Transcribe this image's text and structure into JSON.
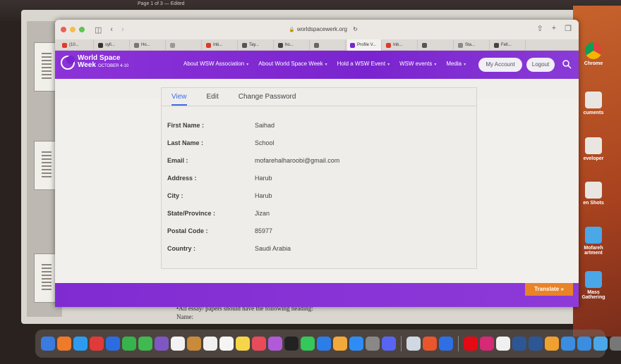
{
  "browser": {
    "url": "worldspacewerk.org",
    "tabs": [
      {
        "label": "(10...",
        "color": "#e03a2f"
      },
      {
        "label": "syll...",
        "color": "#333333"
      },
      {
        "label": "Ho...",
        "color": "#777777"
      },
      {
        "label": "",
        "color": "#999999"
      },
      {
        "label": "Inb...",
        "color": "#d93b2b"
      },
      {
        "label": "Tay...",
        "color": "#555555"
      },
      {
        "label": "ho...",
        "color": "#444444"
      },
      {
        "label": "",
        "color": "#666666"
      },
      {
        "label": "Profile V...",
        "color": "#7a24cf"
      },
      {
        "label": "Inb...",
        "color": "#d93b2b"
      },
      {
        "label": "",
        "color": "#555555"
      },
      {
        "label": "Sta...",
        "color": "#888888"
      },
      {
        "label": "Fell...",
        "color": "#444444"
      }
    ]
  },
  "site": {
    "logo_line1": "World Space",
    "logo_line2": "Week",
    "logo_sub": "OCTOBER 4-10",
    "nav": [
      "About WSW Association",
      "About World Space Week",
      "Hold a WSW Event",
      "WSW events",
      "Media"
    ],
    "my_account": "My Account",
    "logout": "Logout",
    "brand_color": "#7a24cf"
  },
  "profile": {
    "tabs": [
      "View",
      "Edit",
      "Change Password"
    ],
    "fields": [
      {
        "label": "First Name :",
        "value": "Saihad"
      },
      {
        "label": "Last Name :",
        "value": "School"
      },
      {
        "label": "Email :",
        "value": "mofarehalharoobi@gmail.com"
      },
      {
        "label": "Address :",
        "value": "Harub"
      },
      {
        "label": "City :",
        "value": "Harub"
      },
      {
        "label": "State/Province :",
        "value": "Jizan"
      },
      {
        "label": "Postal Code :",
        "value": "85977"
      },
      {
        "label": "Country :",
        "value": "Saudi Arabia"
      }
    ]
  },
  "translate": "Translate »",
  "desktop": {
    "icons": [
      "Chrome",
      "cuments",
      "eveloper",
      "en Shots",
      "Mofareh\nartment",
      "Mass Gathering"
    ],
    "doc_text_line1": "•All essay/ papers should have the following heading:",
    "doc_text_line2": "Name:",
    "toolbar_text": "Page 1 of 3 — Edited"
  }
}
